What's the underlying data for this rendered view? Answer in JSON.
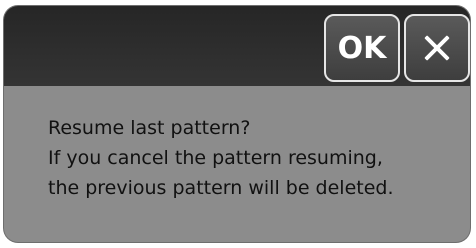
{
  "dialog": {
    "buttons": {
      "ok_label": "OK",
      "close_icon": "close-icon"
    },
    "message_lines": [
      "Resume last pattern?",
      "If you cancel the pattern resuming,",
      "the previous pattern will be deleted."
    ]
  },
  "colors": {
    "titlebar": "#2e2e2e",
    "body": "#8c8c8c",
    "button_border": "#e6e6e6",
    "text": "#111111"
  }
}
